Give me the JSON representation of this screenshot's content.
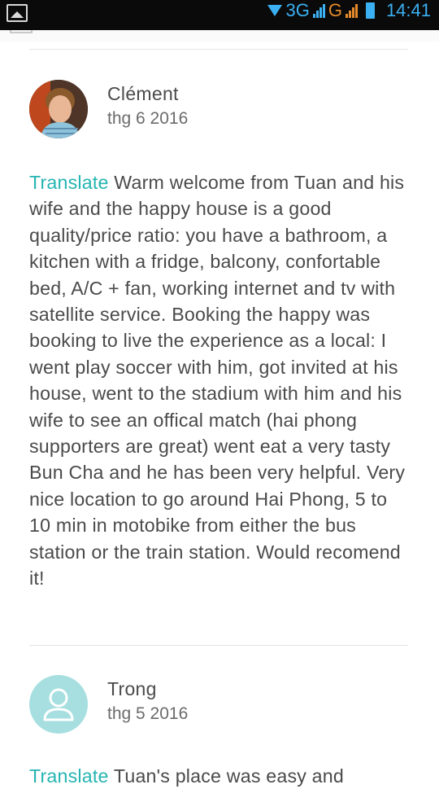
{
  "status_bar": {
    "network_1": "3G",
    "network_2": "G",
    "time": "14:41"
  },
  "reviews": [
    {
      "name": "Clément",
      "date": "thg 6 2016",
      "translate_label": "Translate",
      "text": "Warm welcome from Tuan and his wife and the happy house is a good quality/price ratio: you have a bathroom, a kitchen with a fridge, balcony, confortable bed, A/C + fan, working internet and tv with satellite service. Booking the happy was booking to live the experience as a local: I went play soccer with him, got invited at his house, went to the stadium with him and his wife to see an offical match (hai phong supporters are great) went eat a very tasty Bun Cha and he has been very helpful. Very nice location to go around Hai Phong, 5 to 10 min in motobike from either the bus station or the train station. Would recomend it!"
    },
    {
      "name": "Trong",
      "date": "thg 5 2016",
      "translate_label": "Translate",
      "text": "Tuan's place was easy and"
    }
  ],
  "colors": {
    "accent": "#25b5b2",
    "text": "#4a4a4a",
    "avatar_placeholder": "#a7dfe0",
    "status_blue": "#3bb0f2",
    "status_orange": "#e58a2a"
  }
}
